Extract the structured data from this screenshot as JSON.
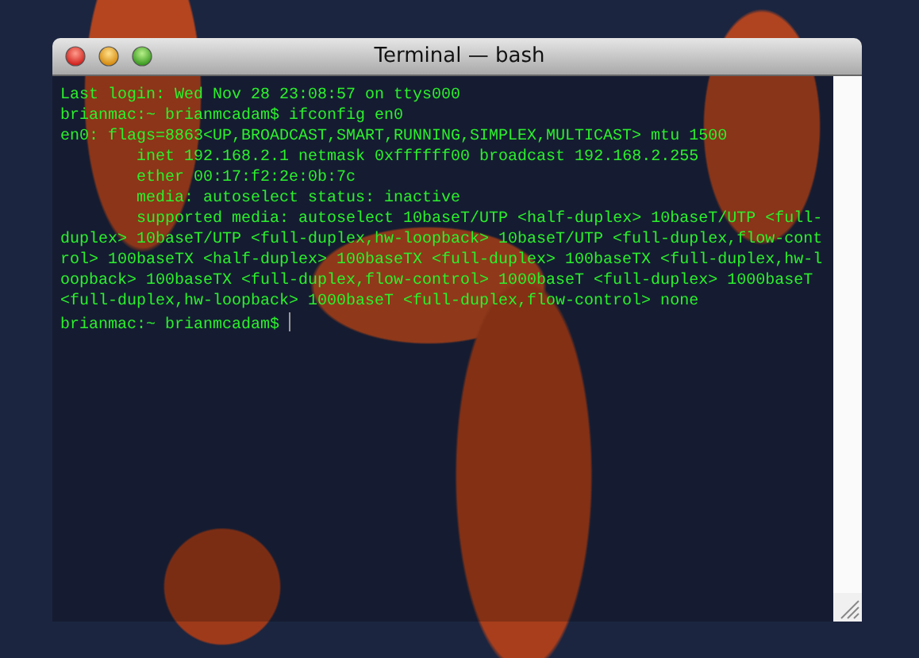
{
  "window": {
    "title": "Terminal — bash"
  },
  "terminal": {
    "lines": [
      "Last login: Wed Nov 28 23:08:57 on ttys000",
      "brianmac:~ brianmcadam$ ifconfig en0",
      "en0: flags=8863<UP,BROADCAST,SMART,RUNNING,SIMPLEX,MULTICAST> mtu 1500",
      "\tinet 192.168.2.1 netmask 0xffffff00 broadcast 192.168.2.255",
      "\tether 00:17:f2:2e:0b:7c",
      "\tmedia: autoselect status: inactive",
      "\tsupported media: autoselect 10baseT/UTP <half-duplex> 10baseT/UTP <full-",
      "duplex> 10baseT/UTP <full-duplex,hw-loopback> 10baseT/UTP <full-duplex,flow-cont",
      "rol> 100baseTX <half-duplex> 100baseTX <full-duplex> 100baseTX <full-duplex,hw-l",
      "oopback> 100baseTX <full-duplex,flow-control> 1000baseT <full-duplex> 1000baseT",
      "<full-duplex,hw-loopback> 1000baseT <full-duplex,flow-control> none"
    ],
    "prompt": {
      "text": "brianmac:~ brianmcadam$ ",
      "cursor": true
    }
  }
}
